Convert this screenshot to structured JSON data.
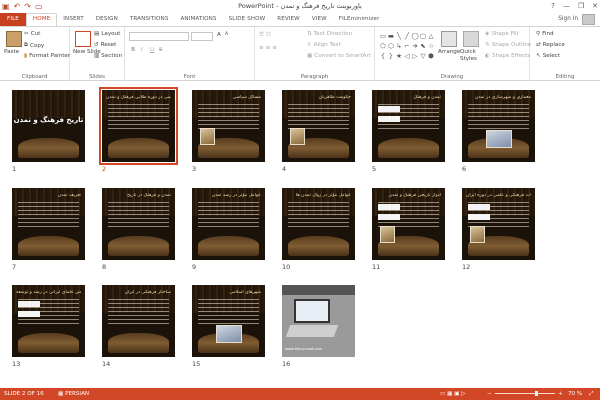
{
  "window": {
    "title": "PowerPoint - باوربوينت تاريخ فرهنگ و تمدن",
    "controls": [
      "?",
      "—",
      "❐",
      "✕"
    ]
  },
  "qat": {
    "icons": [
      "save-icon",
      "undo-icon",
      "redo-icon",
      "present-icon"
    ]
  },
  "tabs": [
    {
      "label": "FILE",
      "active": false
    },
    {
      "label": "HOME",
      "active": true
    },
    {
      "label": "INSERT",
      "active": false
    },
    {
      "label": "DESIGN",
      "active": false
    },
    {
      "label": "TRANSITIONS",
      "active": false
    },
    {
      "label": "ANIMATIONS",
      "active": false
    },
    {
      "label": "SLIDE SHOW",
      "active": false
    },
    {
      "label": "REVIEW",
      "active": false
    },
    {
      "label": "VIEW",
      "active": false
    },
    {
      "label": "FILEminimizer",
      "active": false
    }
  ],
  "account": {
    "signin": "Sign in"
  },
  "ribbon": {
    "clipboard": {
      "label": "Clipboard",
      "paste": "Paste",
      "cut": "Cut",
      "copy": "Copy",
      "format_painter": "Format Painter"
    },
    "slides": {
      "label": "Slides",
      "new_slide": "New Slide",
      "layout": "Layout",
      "reset": "Reset",
      "section": "Section"
    },
    "font": {
      "label": "Font",
      "bold": "B",
      "italic": "I",
      "underline": "U",
      "strike": "S",
      "grow": "A",
      "shrink": "A"
    },
    "paragraph": {
      "label": "Paragraph",
      "text_direction": "Text Direction",
      "align_text": "Align Text",
      "convert": "Convert to SmartArt"
    },
    "drawing": {
      "label": "Drawing",
      "arrange": "Arrange",
      "quick_styles": "Quick Styles",
      "shape_fill": "Shape Fill",
      "shape_outline": "Shape Outline",
      "shape_effects": "Shape Effects",
      "shape_glyphs": [
        "▭",
        "▬",
        "╲",
        "╱",
        "◯",
        "▢",
        "△",
        "⬠",
        "⬡",
        "↳",
        "⌐",
        "➔",
        "⬉",
        "☆",
        "{",
        "}",
        "★",
        "◁",
        "▷",
        "▽",
        "⬢"
      ]
    },
    "editing": {
      "label": "Editing",
      "find": "Find",
      "replace": "Replace",
      "select": "Select"
    }
  },
  "slides": [
    {
      "num": "1",
      "title": "",
      "big_title": "تاريخ فرهنگ و تمدن"
    },
    {
      "num": "2",
      "title": "مشخصات علمی در دوره طلایی فرهنگ و تمدن",
      "selected": true
    },
    {
      "num": "3",
      "title": "مسائل سیاسی",
      "pic": "left"
    },
    {
      "num": "4",
      "title": "حکومت طاهریان",
      "pic": "left"
    },
    {
      "num": "5",
      "title": "تمدن و فرهنگ",
      "bars": true
    },
    {
      "num": "6",
      "title": "معماری و شهرسازی در تمدن",
      "pic": "wide"
    },
    {
      "num": "7",
      "title": "تعريف تمدن"
    },
    {
      "num": "8",
      "title": "تمدن و فرهنگ در تاریخ"
    },
    {
      "num": "9",
      "title": "عوامل مؤثر در رشد تمدن"
    },
    {
      "num": "10",
      "title": "عوامل مؤثر در زوال تمدن ها"
    },
    {
      "num": "11",
      "title": "ادوار تاریخی فرهنگ و تمدن",
      "bars": true,
      "pic": "left"
    },
    {
      "num": "12",
      "title": "تحولات فرهنگی و علمی در دوره ایران",
      "bars": true,
      "pic": "left"
    },
    {
      "num": "13",
      "title": "نقش علمای ایرانی در رشد و توسعه",
      "bars": true
    },
    {
      "num": "14",
      "title": "ساختار فرهنگی در ایران"
    },
    {
      "num": "15",
      "title": "شهرهای اسلامی",
      "pic": "wide"
    },
    {
      "num": "16",
      "title": "",
      "photo": true,
      "caption": "www.filecyrasat.com"
    }
  ],
  "status": {
    "slide_info": "SLIDE 2 OF 16",
    "language": "PERSIAN",
    "zoom": "70 %",
    "zoom_level": 0.7
  },
  "colors": {
    "accent": "#d24726",
    "file_tab": "#c8411f"
  }
}
